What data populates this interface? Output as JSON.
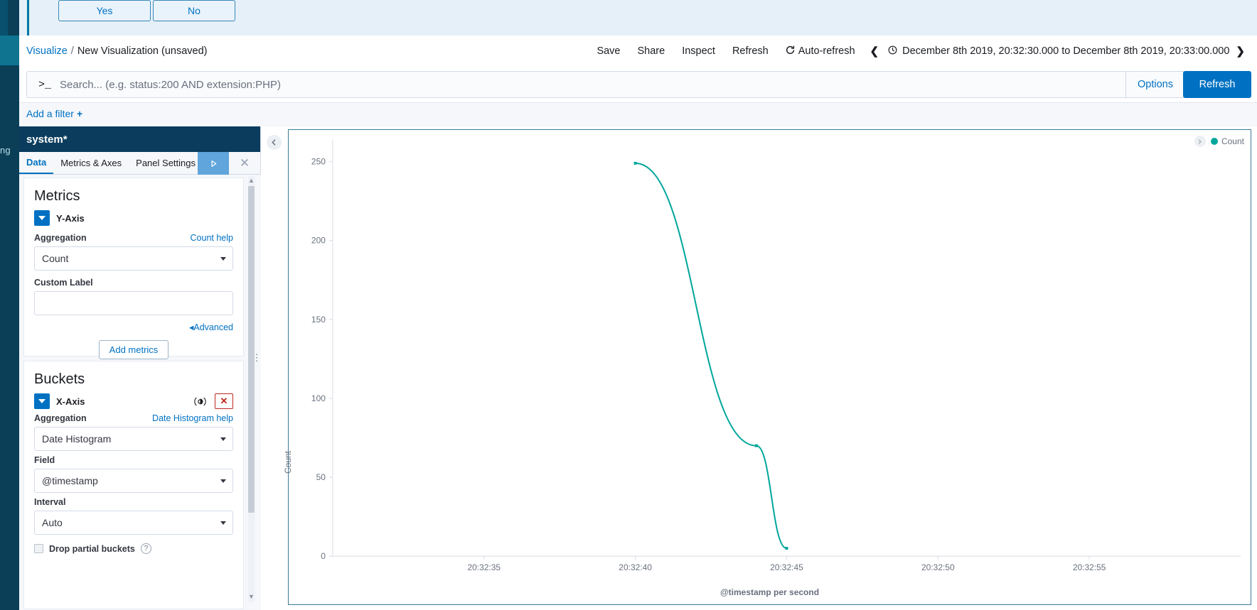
{
  "rail": {
    "partial_text": "ng"
  },
  "banner": {
    "yes_label": "Yes",
    "no_label": "No"
  },
  "topnav": {
    "breadcrumb_root": "Visualize",
    "breadcrumb_sep": "/",
    "breadcrumb_current": "New Visualization (unsaved)",
    "actions": [
      {
        "label": "Save",
        "icon": ""
      },
      {
        "label": "Share",
        "icon": ""
      },
      {
        "label": "Inspect",
        "icon": ""
      },
      {
        "label": "Refresh",
        "icon": ""
      }
    ],
    "autorefresh_label": "Auto-refresh",
    "autorefresh_icon": "refresh-icon",
    "prev_icon": "chevron-left-icon",
    "next_icon": "chevron-right-icon",
    "clock_icon": "clock-icon",
    "date_range": "December 8th 2019, 20:32:30.000 to December 8th 2019, 20:33:00.000"
  },
  "querybar": {
    "prompt_glyph": ">_",
    "value": "",
    "placeholder": "Search... (e.g. status:200 AND extension:PHP)",
    "options_label": "Options",
    "refresh_label": "Refresh"
  },
  "filterbar": {
    "add_filter_label": "Add a filter",
    "plus_glyph": "+"
  },
  "editor": {
    "index_pattern": "system*",
    "tabs": [
      {
        "label": "Data",
        "active": true
      },
      {
        "label": "Metrics & Axes",
        "active": false
      },
      {
        "label": "Panel Settings",
        "active": false
      }
    ],
    "apply_icon": "play-icon",
    "close_icon": "close-icon",
    "metrics": {
      "section_title": "Metrics",
      "agg_name": "Y-Axis",
      "aggregation_label": "Aggregation",
      "aggregation_help": "Count help",
      "aggregation_value": "Count",
      "custom_label_label": "Custom Label",
      "custom_label_value": "",
      "advanced_label": "Advanced",
      "add_metrics_label": "Add metrics"
    },
    "buckets": {
      "section_title": "Buckets",
      "agg_name": "X-Axis",
      "aggregation_label": "Aggregation",
      "aggregation_help": "Date Histogram help",
      "aggregation_value": "Date Histogram",
      "field_label": "Field",
      "field_value": "@timestamp",
      "interval_label": "Interval",
      "interval_value": "Auto",
      "drop_partial_label": "Drop partial buckets",
      "drop_partial_checked": false,
      "eye_icon": "visibility-toggle-icon",
      "remove_icon": "remove-icon",
      "help_icon": "question-icon"
    }
  },
  "chart_panel": {
    "collapse_icon": "chevron-left-circle-icon",
    "legend_collapse_icon": "chevron-right-circle-icon"
  },
  "colors": {
    "accent": "#0071c2",
    "series": "#00a69b",
    "panel_header": "#0b3c5d",
    "danger": "#bd271e"
  },
  "chart_data": {
    "type": "line",
    "title": "",
    "xlabel": "@timestamp per second",
    "ylabel": "Count",
    "legend": [
      "Count"
    ],
    "legend_position": "top-right",
    "grid": false,
    "ylim": [
      0,
      262
    ],
    "yticks": [
      0,
      50,
      100,
      150,
      200,
      250
    ],
    "ytick_labels": [
      "0",
      "50",
      "100",
      "150",
      "200",
      "250"
    ],
    "xticks": [
      "20:32:35",
      "20:32:40",
      "20:32:45",
      "20:32:50",
      "20:32:55"
    ],
    "series": [
      {
        "name": "Count",
        "color": "#00a69b",
        "points": [
          {
            "x": "20:32:40",
            "y": 249
          },
          {
            "x": "20:32:44",
            "y": 70
          },
          {
            "x": "20:32:45",
            "y": 5
          }
        ]
      }
    ]
  }
}
